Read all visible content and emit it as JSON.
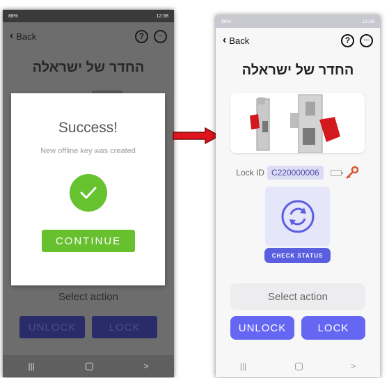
{
  "left_screen": {
    "status": {
      "left": "88%",
      "time": "12:38"
    },
    "nav": {
      "back_label": "Back",
      "help_icon": "?",
      "more_icon": "···"
    },
    "title": "החדר של ישראלה",
    "dialog": {
      "title": "Success!",
      "message": "New offline key was created",
      "continue_label": "CONTINUE"
    },
    "select_action": "Select action",
    "unlock_label": "UNLOCK",
    "lock_label": "LOCK",
    "system_nav": {
      "recents": "|||",
      "home": "",
      "back": ">"
    }
  },
  "right_screen": {
    "status": {
      "left": "88%",
      "time": "12:38"
    },
    "nav": {
      "back_label": "Back",
      "help_icon": "?",
      "more_icon": "···"
    },
    "title": "החדר של ישראלה",
    "lock_id_label": "Lock ID",
    "lock_id_value": "C220000006",
    "check_status_label": "CHECK STATUS",
    "select_action": "Select action",
    "unlock_label": "UNLOCK",
    "lock_label": "LOCK",
    "system_nav": {
      "recents": "|||",
      "home": "",
      "back": ">"
    }
  },
  "colors": {
    "success_green": "#66c22f",
    "primary_purple": "#6567f2",
    "arrow_red": "#e0141c",
    "key_orange": "#d9532b"
  },
  "icons": [
    "chevron-left-icon",
    "help-icon",
    "more-icon",
    "checkmark-icon",
    "battery-icon",
    "key-icon",
    "refresh-icon",
    "right-arrow-icon"
  ]
}
